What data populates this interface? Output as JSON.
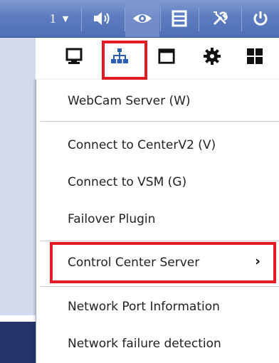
{
  "toolbar": {
    "channel_number": "1",
    "items": [
      {
        "icon": "speaker-icon"
      },
      {
        "icon": "eye-icon"
      },
      {
        "icon": "film-strip-icon"
      },
      {
        "icon": "tools-icon"
      },
      {
        "icon": "power-icon"
      }
    ]
  },
  "icon_row": {
    "items": [
      {
        "icon": "monitor-icon"
      },
      {
        "icon": "network-icon"
      },
      {
        "icon": "window-icon"
      },
      {
        "icon": "gear-icon"
      },
      {
        "icon": "windows-grid-icon"
      }
    ]
  },
  "menu": {
    "items": [
      {
        "label": "WebCam Server (W)"
      },
      {
        "label": "Connect to CenterV2 (V)"
      },
      {
        "label": "Connect to VSM (G)"
      },
      {
        "label": "Failover Plugin"
      },
      {
        "label": "Control Center Server"
      },
      {
        "label": "Network Port Information"
      },
      {
        "label": "Network failure detection"
      }
    ],
    "submenu_indicator": "›"
  },
  "colors": {
    "highlight": "#e51a25",
    "toolbar_blue": "#5d7cc0"
  }
}
